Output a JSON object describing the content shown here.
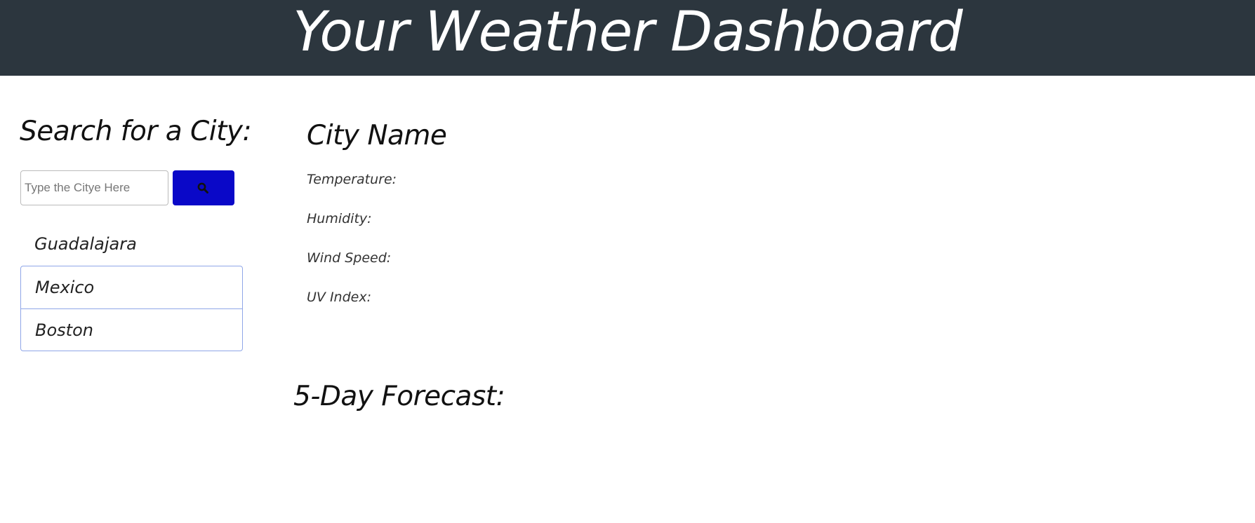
{
  "header": {
    "title": "Your Weather Dashboard"
  },
  "sidebar": {
    "heading": "Search for a City:",
    "search": {
      "placeholder": "Type the Citye Here",
      "value": "",
      "button_icon": "search-icon"
    },
    "history": [
      {
        "label": "Guadalajara"
      },
      {
        "label": "Mexico"
      },
      {
        "label": "Boston"
      }
    ]
  },
  "main": {
    "city_name": "City Name",
    "metrics": {
      "temperature": "Temperature:",
      "humidity": "Humidity:",
      "wind_speed": "Wind Speed:",
      "uv_index": "UV Index:"
    },
    "forecast_heading": "5-Day Forecast:"
  },
  "colors": {
    "header_bg": "#2c363e",
    "search_button": "#0a08c8",
    "history_border": "#8fa6e8"
  }
}
